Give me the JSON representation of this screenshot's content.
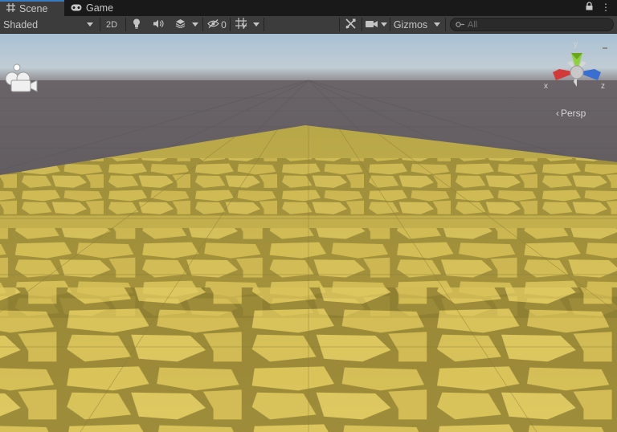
{
  "tabs": [
    {
      "label": "Scene",
      "icon": "grid-icon",
      "active": true
    },
    {
      "label": "Game",
      "icon": "gamepad-icon",
      "active": false
    }
  ],
  "toolbar": {
    "draw_mode": "Shaded",
    "mode_2d": "2D",
    "hidden_count": "0",
    "gizmos": "Gizmos",
    "search_placeholder": "All"
  },
  "viewport": {
    "projection_label": "Persp",
    "axes": {
      "x": "x",
      "y": "y",
      "z": "z"
    },
    "colors": {
      "x_axis": "#d23a3a",
      "y_axis": "#8ed23a",
      "z_axis": "#3a6fd2",
      "ground": "#d8c25a",
      "sky": "#a9c1d4"
    }
  }
}
